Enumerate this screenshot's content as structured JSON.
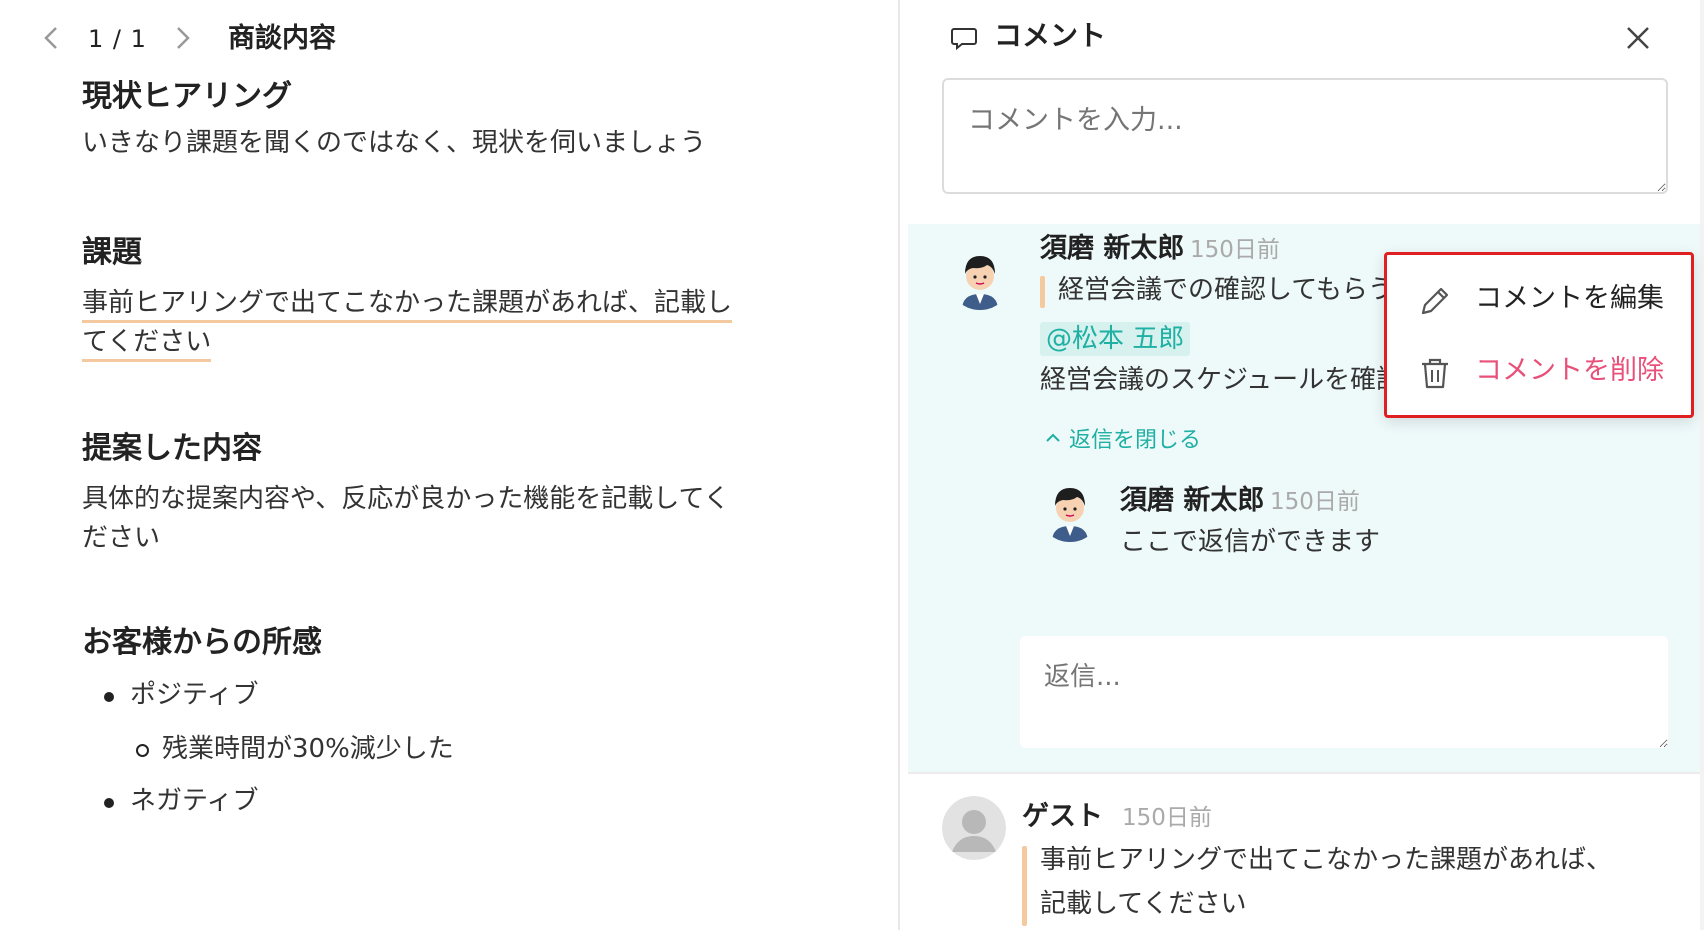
{
  "document": {
    "nav": {
      "page_counter": "1 / 1"
    },
    "title": "商談内容",
    "sections": [
      {
        "heading": "現状ヒアリング",
        "body": "いきなり課題を聞くのではなく、現状を伺いましょう"
      },
      {
        "heading": "課題",
        "body_line1": "事前ヒアリングで出てこなかった課題があれば、記載し",
        "body_line2": "てください"
      },
      {
        "heading": "提案した内容",
        "body_line1": "具体的な提案内容や、反応が良かった機能を記載してく",
        "body_line2": "ださい"
      },
      {
        "heading": "お客様からの所感"
      }
    ],
    "feedback_list": {
      "positive": "ポジティブ",
      "positive_sub": "残業時間が30%減少した",
      "negative": "ネガティブ"
    }
  },
  "panel": {
    "title": "コメント",
    "input_placeholder": "コメントを入力...",
    "thread": {
      "author": "須磨 新太郎",
      "time": "150日前",
      "quote": "経営会議での確認してもらう",
      "mention": "@松本 五郎",
      "text": "経営会議のスケジュールを確認",
      "collapse_label": "返信を閉じる",
      "reply": {
        "author": "須磨 新太郎",
        "time": "150日前",
        "text": "ここで返信ができます"
      },
      "reply_placeholder": "返信..."
    },
    "guest_comment": {
      "author": "ゲスト",
      "time": "150日前",
      "text_line1": "事前ヒアリングで出てこなかった課題があれば、",
      "text_line2": "記載してください"
    }
  },
  "context_menu": {
    "edit_label": "コメントを編集",
    "delete_label": "コメントを削除"
  },
  "colors": {
    "accent": "#1fb0a3",
    "danger": "#e8507a",
    "highlight_underline": "#f5c9a0",
    "thread_bg": "#eef9fa",
    "menu_border": "#e02020"
  }
}
